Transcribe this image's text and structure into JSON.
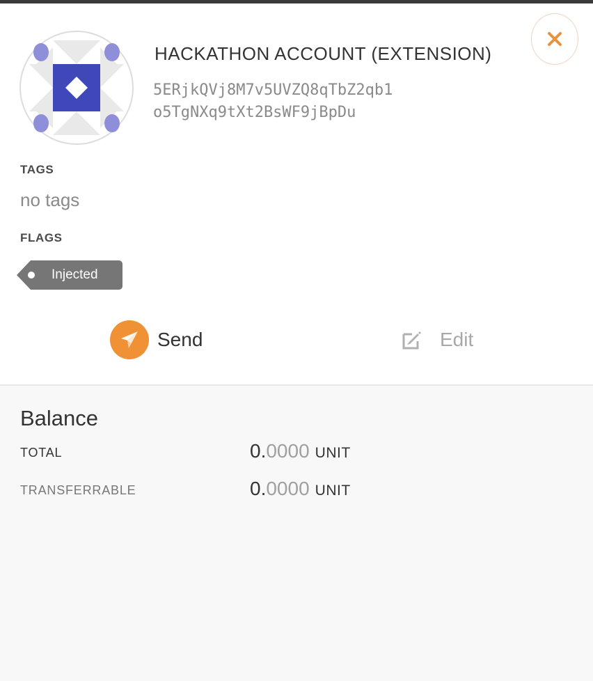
{
  "account": {
    "name": "HACKATHON ACCOUNT (EXTENSION)",
    "address_line1": "5ERjkQVj8M7v5UVZQ8qTbZ2qb1",
    "address_line2": "o5TgNXq9tXt2BsWF9jBpDu"
  },
  "tags": {
    "label": "TAGS",
    "empty_text": "no tags"
  },
  "flags": {
    "label": "FLAGS",
    "items": [
      "Injected"
    ]
  },
  "actions": {
    "send_label": "Send",
    "edit_label": "Edit"
  },
  "balance": {
    "title": "Balance",
    "rows": [
      {
        "label": "TOTAL",
        "integer": "0.",
        "decimals": "0000",
        "unit": "UNIT"
      },
      {
        "label": "TRANSFERRABLE",
        "integer": "0.",
        "decimals": "0000",
        "unit": "UNIT"
      }
    ]
  },
  "icons": {
    "close": "close-icon",
    "send": "send-icon",
    "edit": "edit-icon",
    "identicon": "account-identicon"
  },
  "colors": {
    "accent": "#f19135",
    "identicon_primary": "#3f48b8",
    "identicon_dots": "#8e8fd8",
    "flag_bg": "#767676"
  }
}
